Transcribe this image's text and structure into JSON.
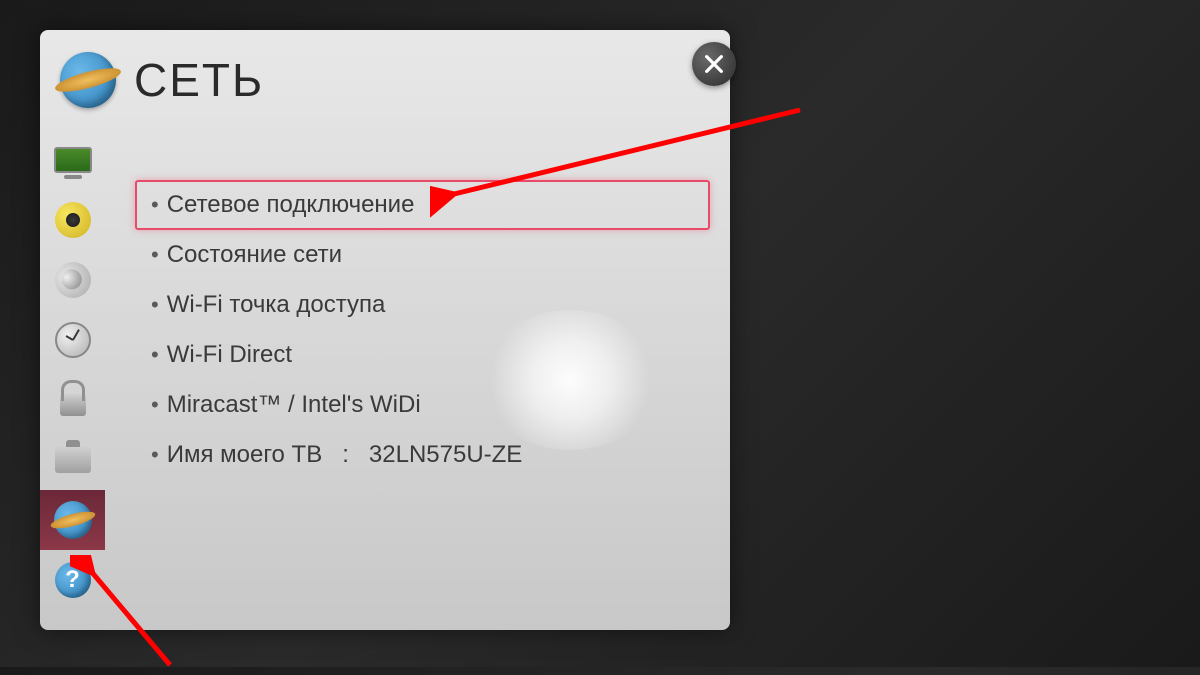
{
  "header": {
    "title": "СЕТЬ"
  },
  "sidebar": {
    "items": [
      {
        "name": "picture",
        "active": false
      },
      {
        "name": "sound",
        "active": false
      },
      {
        "name": "channels",
        "active": false
      },
      {
        "name": "time",
        "active": false
      },
      {
        "name": "lock",
        "active": false
      },
      {
        "name": "general",
        "active": false
      },
      {
        "name": "network",
        "active": true
      },
      {
        "name": "support",
        "active": false
      }
    ]
  },
  "menu": {
    "items": [
      {
        "label": "Сетевое подключение",
        "highlighted": true
      },
      {
        "label": "Состояние сети",
        "highlighted": false
      },
      {
        "label": "Wi-Fi точка доступа",
        "highlighted": false
      },
      {
        "label": "Wi-Fi Direct",
        "highlighted": false
      },
      {
        "label": "Miracast™ / Intel's WiDi",
        "highlighted": false
      },
      {
        "label": "Имя моего ТВ",
        "value": "32LN575U-ZE",
        "highlighted": false
      }
    ]
  },
  "annotations": {
    "arrow1_target": "network-connection-item",
    "arrow2_target": "sidebar-network-item"
  }
}
